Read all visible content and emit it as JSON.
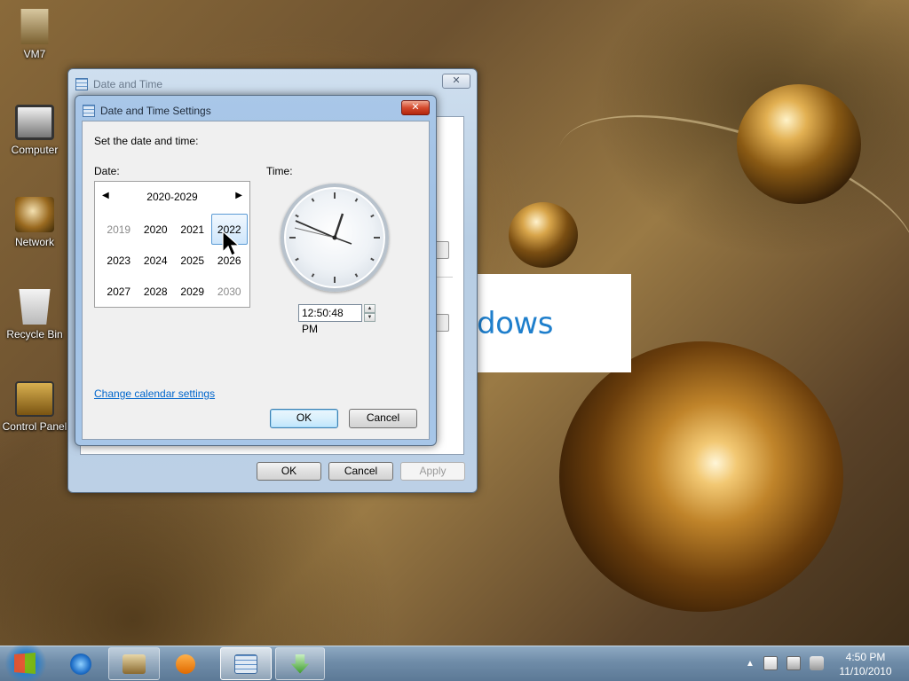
{
  "desktop": {
    "icons": [
      {
        "label": "VM7"
      },
      {
        "label": "Computer"
      },
      {
        "label": "Network"
      },
      {
        "label": "Recycle Bin"
      },
      {
        "label": "Control Panel"
      }
    ],
    "splash_text": "dows"
  },
  "outer_window": {
    "title": "Date and Time",
    "ok": "OK",
    "cancel": "Cancel",
    "apply": "Apply"
  },
  "dialog": {
    "title": "Date and Time Settings",
    "instruction": "Set the date and time:",
    "date_label": "Date:",
    "time_label": "Time:",
    "calendar": {
      "header": "2020-2029",
      "years": [
        {
          "label": "2019",
          "dim": true
        },
        {
          "label": "2020",
          "dim": false
        },
        {
          "label": "2021",
          "dim": false
        },
        {
          "label": "2022",
          "dim": false,
          "selected": true
        },
        {
          "label": "2023",
          "dim": false
        },
        {
          "label": "2024",
          "dim": false
        },
        {
          "label": "2025",
          "dim": false
        },
        {
          "label": "2026",
          "dim": false
        },
        {
          "label": "2027",
          "dim": false
        },
        {
          "label": "2028",
          "dim": false
        },
        {
          "label": "2029",
          "dim": false
        },
        {
          "label": "2030",
          "dim": true
        }
      ]
    },
    "time_value": "12:50:48 PM",
    "change_calendar_link": "Change calendar settings",
    "ok": "OK",
    "cancel": "Cancel"
  },
  "taskbar": {
    "time": "4:50 PM",
    "date": "11/10/2010"
  }
}
